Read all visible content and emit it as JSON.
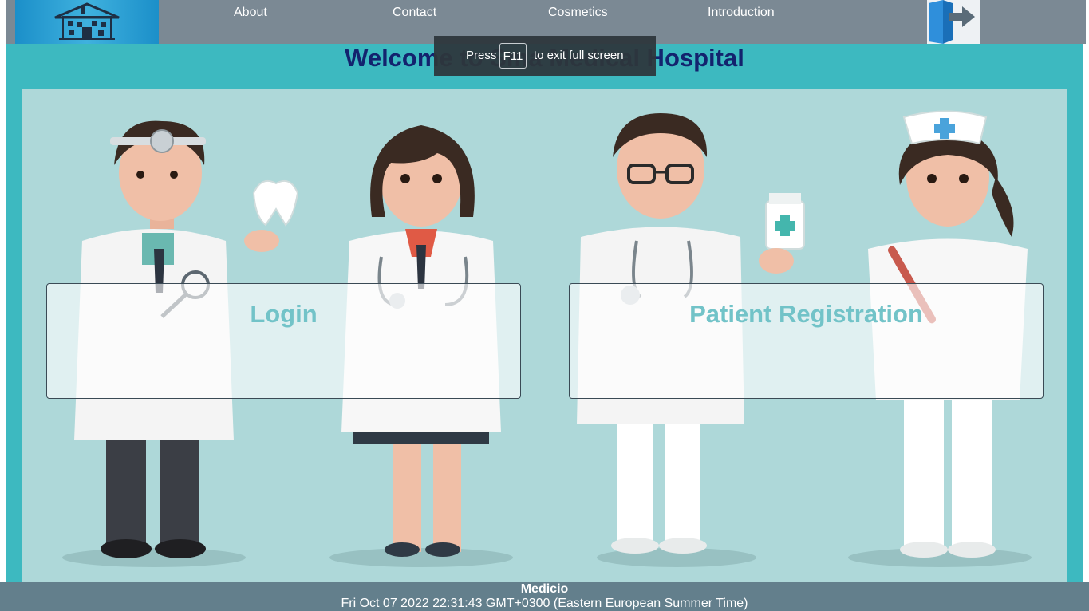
{
  "nav": {
    "items": [
      {
        "label": "About"
      },
      {
        "label": "Contact"
      },
      {
        "label": "Cosmetics"
      },
      {
        "label": "Introduction"
      }
    ],
    "logo_icon": "house-icon",
    "exit_icon": "exit-door-icon"
  },
  "header": {
    "title": "Welcome to Sma Medical Hospital"
  },
  "cards": {
    "login_label": "Login",
    "registration_label": "Patient Registration"
  },
  "fullscreen_toast": {
    "press": "Press",
    "key": "F11",
    "message": "to exit full screen"
  },
  "footer": {
    "brand": "Medicio",
    "datetime": "Fri Oct 07 2022 22:31:43 GMT+0300 (Eastern European Summer Time)"
  },
  "colors": {
    "nav_bg": "#7b8994",
    "main_bg": "#3db9c0",
    "hero_bg": "#aed8d9",
    "title": "#13236e",
    "card_text": "#72c3c8",
    "footer_bg": "#637f8c"
  }
}
